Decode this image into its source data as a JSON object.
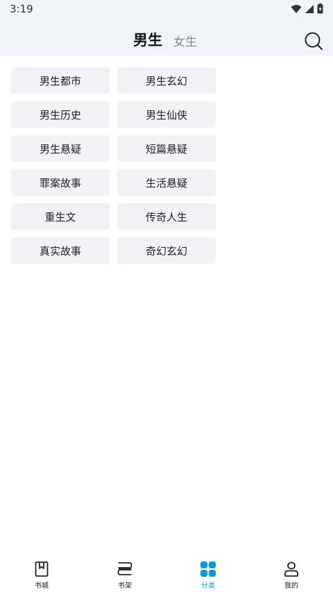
{
  "status_bar": {
    "time": "3:19",
    "icons": [
      "wifi-icon",
      "signal-icon",
      "battery-charging-icon"
    ]
  },
  "header": {
    "tabs": [
      {
        "label": "男生",
        "active": true
      },
      {
        "label": "女生",
        "active": false
      }
    ],
    "search_icon": "search-icon"
  },
  "categories": [
    "男生都市",
    "男生玄幻",
    "男生历史",
    "男生仙侠",
    "男生悬疑",
    "短篇悬疑",
    "罪案故事",
    "生活悬疑",
    "重生文",
    "传奇人生",
    "真实故事",
    "奇幻玄幻"
  ],
  "bottom_nav": [
    {
      "label": "书城",
      "icon": "bookmark-book-icon",
      "active": false
    },
    {
      "label": "书架",
      "icon": "bookshelf-icon",
      "active": false
    },
    {
      "label": "分类",
      "icon": "grid-category-icon",
      "active": true
    },
    {
      "label": "我的",
      "icon": "user-icon",
      "active": false
    }
  ],
  "colors": {
    "header_bg": "#f0f3f7",
    "chip_bg": "#f0f2f5",
    "accent": "#1296db"
  }
}
